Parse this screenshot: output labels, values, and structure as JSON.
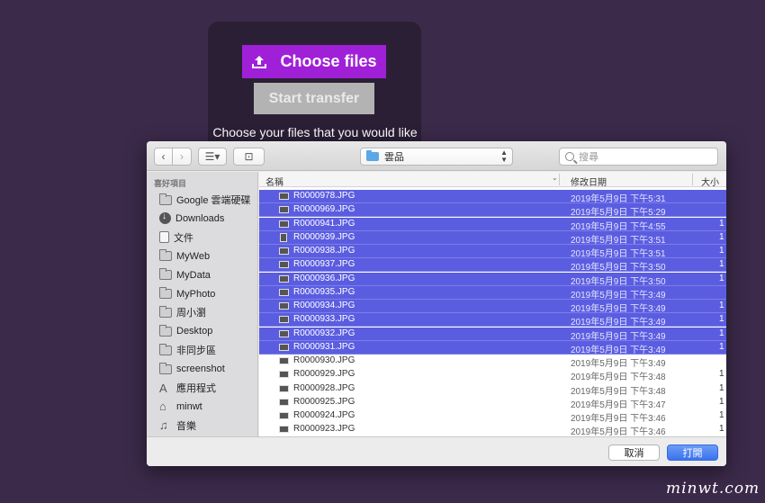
{
  "upload": {
    "choose_label": "Choose files",
    "start_label": "Start transfer",
    "prompt_text": "Choose your files that you would like"
  },
  "toolbar": {
    "back_icon": "chevron-left",
    "forward_icon": "chevron-right",
    "view_icon": "list-view",
    "new_folder_icon": "folder-plus",
    "location": "雲品",
    "search_placeholder": "搜尋"
  },
  "sidebar": {
    "header": "喜好項目",
    "items": [
      {
        "label": "Google 雲端硬碟",
        "icon": "folder"
      },
      {
        "label": "Downloads",
        "icon": "download"
      },
      {
        "label": "文件",
        "icon": "doc"
      },
      {
        "label": "MyWeb",
        "icon": "folder"
      },
      {
        "label": "MyData",
        "icon": "folder"
      },
      {
        "label": "MyPhoto",
        "icon": "folder"
      },
      {
        "label": "周小瀏",
        "icon": "folder"
      },
      {
        "label": "Desktop",
        "icon": "folder"
      },
      {
        "label": "非同步區",
        "icon": "folder"
      },
      {
        "label": "screenshot",
        "icon": "folder"
      },
      {
        "label": "應用程式",
        "icon": "app"
      },
      {
        "label": "minwt",
        "icon": "home"
      },
      {
        "label": "音樂",
        "icon": "music"
      }
    ]
  },
  "list": {
    "col_name": "名稱",
    "col_date": "修改日期",
    "col_size": "大小",
    "rows": [
      {
        "name": "R0000978.JPG",
        "date": "2019年5月9日 下午5:31",
        "size": "",
        "selected": true,
        "portrait": false
      },
      {
        "name": "R0000969.JPG",
        "date": "2019年5月9日 下午5:29",
        "size": "",
        "selected": true,
        "portrait": false
      },
      {
        "name": "R0000941.JPG",
        "date": "2019年5月9日 下午4:55",
        "size": "1",
        "selected": true,
        "portrait": false
      },
      {
        "name": "R0000939.JPG",
        "date": "2019年5月9日 下午3:51",
        "size": "1",
        "selected": true,
        "portrait": true
      },
      {
        "name": "R0000938.JPG",
        "date": "2019年5月9日 下午3:51",
        "size": "1",
        "selected": true,
        "portrait": false
      },
      {
        "name": "R0000937.JPG",
        "date": "2019年5月9日 下午3:50",
        "size": "1",
        "selected": true,
        "portrait": false
      },
      {
        "name": "R0000936.JPG",
        "date": "2019年5月9日 下午3:50",
        "size": "1",
        "selected": true,
        "portrait": false
      },
      {
        "name": "R0000935.JPG",
        "date": "2019年5月9日 下午3:49",
        "size": "",
        "selected": true,
        "portrait": false
      },
      {
        "name": "R0000934.JPG",
        "date": "2019年5月9日 下午3:49",
        "size": "1",
        "selected": true,
        "portrait": false
      },
      {
        "name": "R0000933.JPG",
        "date": "2019年5月9日 下午3:49",
        "size": "1",
        "selected": true,
        "portrait": false
      },
      {
        "name": "R0000932.JPG",
        "date": "2019年5月9日 下午3:49",
        "size": "1",
        "selected": true,
        "portrait": false
      },
      {
        "name": "R0000931.JPG",
        "date": "2019年5月9日 下午3:49",
        "size": "1",
        "selected": true,
        "portrait": false
      },
      {
        "name": "R0000930.JPG",
        "date": "2019年5月9日 下午3:49",
        "size": "",
        "selected": false,
        "portrait": false
      },
      {
        "name": "R0000929.JPG",
        "date": "2019年5月9日 下午3:48",
        "size": "1",
        "selected": false,
        "portrait": false
      },
      {
        "name": "R0000928.JPG",
        "date": "2019年5月9日 下午3:48",
        "size": "1",
        "selected": false,
        "portrait": false
      },
      {
        "name": "R0000925.JPG",
        "date": "2019年5月9日 下午3:47",
        "size": "1",
        "selected": false,
        "portrait": false
      },
      {
        "name": "R0000924.JPG",
        "date": "2019年5月9日 下午3:46",
        "size": "1",
        "selected": false,
        "portrait": false
      },
      {
        "name": "R0000923.JPG",
        "date": "2019年5月9日 下午3:46",
        "size": "1",
        "selected": false,
        "portrait": false
      }
    ]
  },
  "footer": {
    "cancel_label": "取消",
    "open_label": "打開"
  },
  "watermark": "minwt.com",
  "colors": {
    "background": "#3b2a4a",
    "choose_button": "#a020d8",
    "start_button": "#b3b3b3",
    "selection": "#5b5de0",
    "open_button": "#3a72ee"
  }
}
